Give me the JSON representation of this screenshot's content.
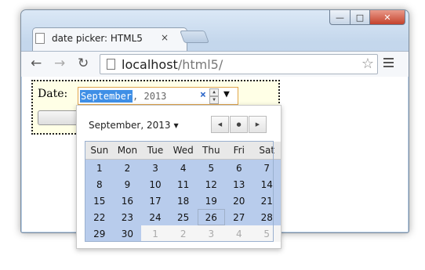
{
  "window": {
    "tab_title": "date picker: HTML5",
    "tab_close": "×",
    "min_glyph": "—",
    "max_glyph": "□",
    "close_glyph": "✕"
  },
  "toolbar": {
    "back": "←",
    "forward": "→",
    "reload": "↻",
    "url_host": "localhost",
    "url_path": "/html5/",
    "star": "☆"
  },
  "form": {
    "label": "Date:",
    "month_value": "September",
    "rest_value": ", 2013",
    "clear_glyph": "×",
    "spin_up": "▲",
    "spin_down": "▼",
    "dropdown_glyph": "▼"
  },
  "picker": {
    "heading": "September, 2013",
    "heading_caret": "▼",
    "prev_glyph": "◀",
    "today_glyph": "●",
    "next_glyph": "▶",
    "weekdays": [
      "Sun",
      "Mon",
      "Tue",
      "Wed",
      "Thu",
      "Fri",
      "Sat"
    ],
    "weeks": [
      [
        {
          "d": "1"
        },
        {
          "d": "2"
        },
        {
          "d": "3"
        },
        {
          "d": "4"
        },
        {
          "d": "5"
        },
        {
          "d": "6"
        },
        {
          "d": "7"
        }
      ],
      [
        {
          "d": "8"
        },
        {
          "d": "9"
        },
        {
          "d": "10"
        },
        {
          "d": "11"
        },
        {
          "d": "12"
        },
        {
          "d": "13"
        },
        {
          "d": "14"
        }
      ],
      [
        {
          "d": "15"
        },
        {
          "d": "16"
        },
        {
          "d": "17"
        },
        {
          "d": "18"
        },
        {
          "d": "19"
        },
        {
          "d": "20"
        },
        {
          "d": "21"
        }
      ],
      [
        {
          "d": "22"
        },
        {
          "d": "23"
        },
        {
          "d": "24"
        },
        {
          "d": "25"
        },
        {
          "d": "26",
          "today": true
        },
        {
          "d": "27"
        },
        {
          "d": "28"
        }
      ],
      [
        {
          "d": "29"
        },
        {
          "d": "30"
        },
        {
          "d": "1",
          "out": true
        },
        {
          "d": "2",
          "out": true
        },
        {
          "d": "3",
          "out": true
        },
        {
          "d": "4",
          "out": true
        },
        {
          "d": "5",
          "out": true
        }
      ]
    ]
  }
}
